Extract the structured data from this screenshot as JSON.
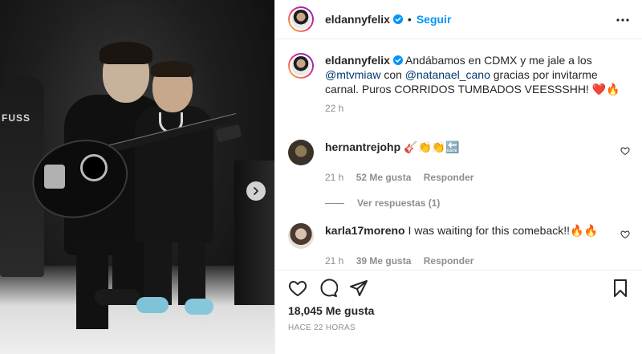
{
  "media": {
    "background_text": "FUSS"
  },
  "header": {
    "username": "eldannyfelix",
    "separator": "•",
    "follow_label": "Seguir"
  },
  "caption": {
    "username": "eldannyfelix",
    "text_part1": "Andábamos en CDMX y me jale a los ",
    "mention1": "@mtvmiaw",
    "text_part2": " con ",
    "mention2": "@natanael_cano",
    "text_part3": " gracias por invitarme carnal. Puros CORRIDOS TUMBADOS VEESSSHH! ❤️🔥",
    "time": "22 h"
  },
  "comments": [
    {
      "username": "hernantrejohp",
      "text": "🎸👏👏🔙",
      "time": "21 h",
      "likes": "52 Me gusta",
      "reply_label": "Responder",
      "view_replies": "Ver respuestas (1)"
    },
    {
      "username": "karla17moreno",
      "text": "I was waiting for this comeback!!🔥🔥",
      "time": "21 h",
      "likes": "39 Me gusta",
      "reply_label": "Responder"
    }
  ],
  "footer": {
    "likes": "18,045 Me gusta",
    "posted": "HACE 22 HORAS"
  },
  "colors": {
    "accent": "#0095f6",
    "mention": "#00376b",
    "muted": "#8e8e8e",
    "text": "#262626"
  },
  "icons": [
    "verified-icon",
    "more-options-icon",
    "heart-icon",
    "comment-icon",
    "share-icon",
    "save-icon",
    "next-arrow-icon"
  ]
}
